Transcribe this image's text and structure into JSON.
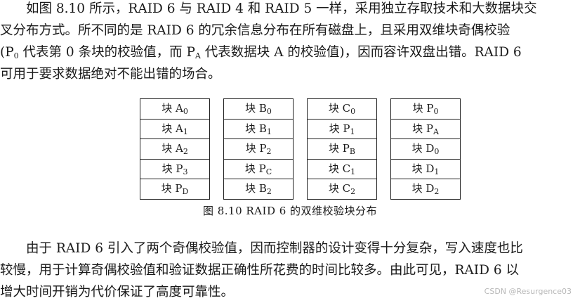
{
  "paragraph1": {
    "line1": "如图 8.10 所示，RAID 6 与 RAID 4 和 RAID 5 一样，采用独立存取技术和大数据块交",
    "line2": "叉分布方式。所不同的是 RAID 6 的冗余信息分布在所有磁盘上，且采用双维块奇偶校验",
    "line3_before_p0": "(P",
    "line3_p0_sub": "0",
    "line3_mid": " 代表第 0 条块的校验值，而 P",
    "line3_pa_sub": "A",
    "line3_after": " 代表数据块 A 的校验值)，因而容许双盘出错。RAID 6",
    "line4": "可用于要求数据绝对不能出错的场合。"
  },
  "figure": {
    "disks": [
      {
        "cells": [
          {
            "prefix": "块 ",
            "main": "A",
            "sub": "0"
          },
          {
            "prefix": "块 ",
            "main": "A",
            "sub": "1"
          },
          {
            "prefix": "块 ",
            "main": "A",
            "sub": "2"
          },
          {
            "prefix": "块 ",
            "main": "P",
            "sub": "3"
          },
          {
            "prefix": "块 ",
            "main": "P",
            "sub": "D"
          }
        ]
      },
      {
        "cells": [
          {
            "prefix": "块 ",
            "main": "B",
            "sub": "0"
          },
          {
            "prefix": "块 ",
            "main": "B",
            "sub": "1"
          },
          {
            "prefix": "块 ",
            "main": "P",
            "sub": "2"
          },
          {
            "prefix": "块 ",
            "main": "P",
            "sub": "C"
          },
          {
            "prefix": "块 ",
            "main": "B",
            "sub": "2"
          }
        ]
      },
      {
        "cells": [
          {
            "prefix": "块 ",
            "main": "C",
            "sub": "0"
          },
          {
            "prefix": "块 ",
            "main": "P",
            "sub": "1"
          },
          {
            "prefix": "块 ",
            "main": "P",
            "sub": "B"
          },
          {
            "prefix": "块 ",
            "main": "C",
            "sub": "1"
          },
          {
            "prefix": "块 ",
            "main": "C",
            "sub": "2"
          }
        ]
      },
      {
        "cells": [
          {
            "prefix": "块 ",
            "main": "P",
            "sub": "0"
          },
          {
            "prefix": "块 ",
            "main": "P",
            "sub": "A"
          },
          {
            "prefix": "块 ",
            "main": "D",
            "sub": "0"
          },
          {
            "prefix": "块 ",
            "main": "D",
            "sub": "1"
          },
          {
            "prefix": "块 ",
            "main": "D",
            "sub": "2"
          }
        ]
      }
    ],
    "caption": "图 8.10   RAID 6 的双维校验块分布"
  },
  "paragraph2": {
    "line1": "由于 RAID 6 引入了两个奇偶校验值，因而控制器的设计变得十分复杂，写入速度也比",
    "line2": "较慢，用于计算奇偶校验值和验证数据正确性所花费的时间比较多。由此可见，RAID 6 以",
    "line3": "增大时间开销为代价保证了高度可靠性。"
  },
  "watermark": "CSDN @Resurgence03"
}
